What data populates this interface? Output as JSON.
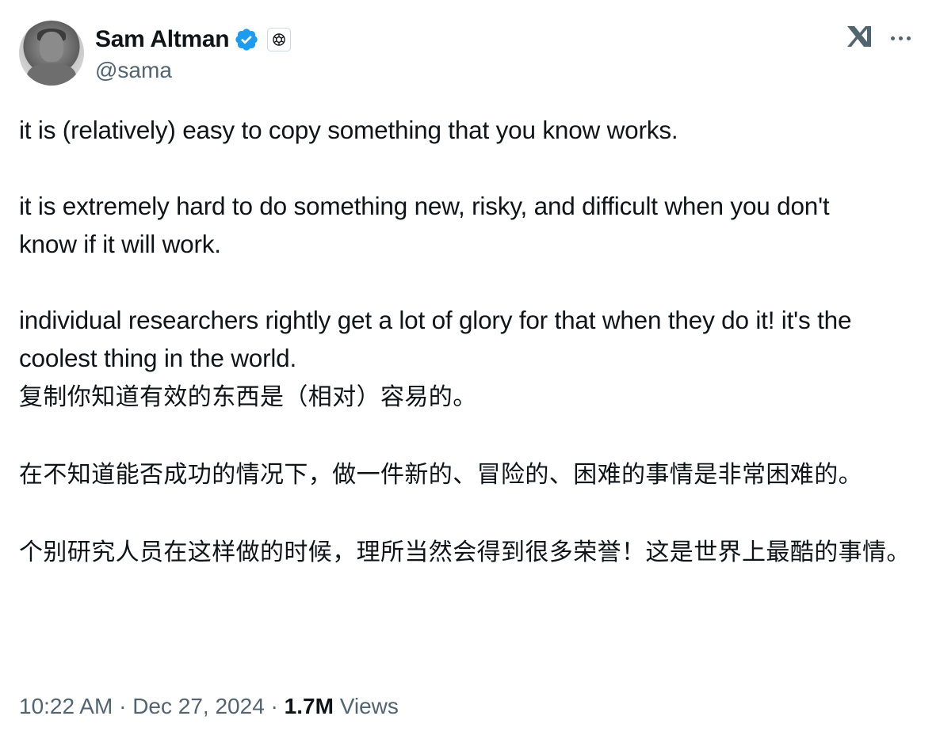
{
  "author": {
    "name": "Sam Altman",
    "handle": "@sama",
    "verified_color": "#1d9bf0"
  },
  "icons": {
    "verified": "verified-badge-icon",
    "affiliation": "openai-affiliation-icon",
    "platform": "x-logo-icon",
    "more": "more-options-icon"
  },
  "tweet": {
    "english": {
      "p1": "it is (relatively) easy to copy something that you know works.",
      "p2": "it is extremely hard to do something new, risky, and difficult when you don't know if it will work.",
      "p3": "individual researchers rightly get a lot of glory for that when they do it! it's the coolest thing in the world."
    },
    "chinese": {
      "p1": "复制你知道有效的东西是（相对）容易的。",
      "p2": "在不知道能否成功的情况下，做一件新的、冒险的、困难的事情是非常困难的。",
      "p3": "个别研究人员在这样做的时候，理所当然会得到很多荣誉！这是世界上最酷的事情。"
    }
  },
  "meta": {
    "time": "10:22 AM",
    "separator": " · ",
    "date": "Dec 27, 2024",
    "separator2": " · ",
    "views_count": "1.7M",
    "views_label": " Views"
  }
}
